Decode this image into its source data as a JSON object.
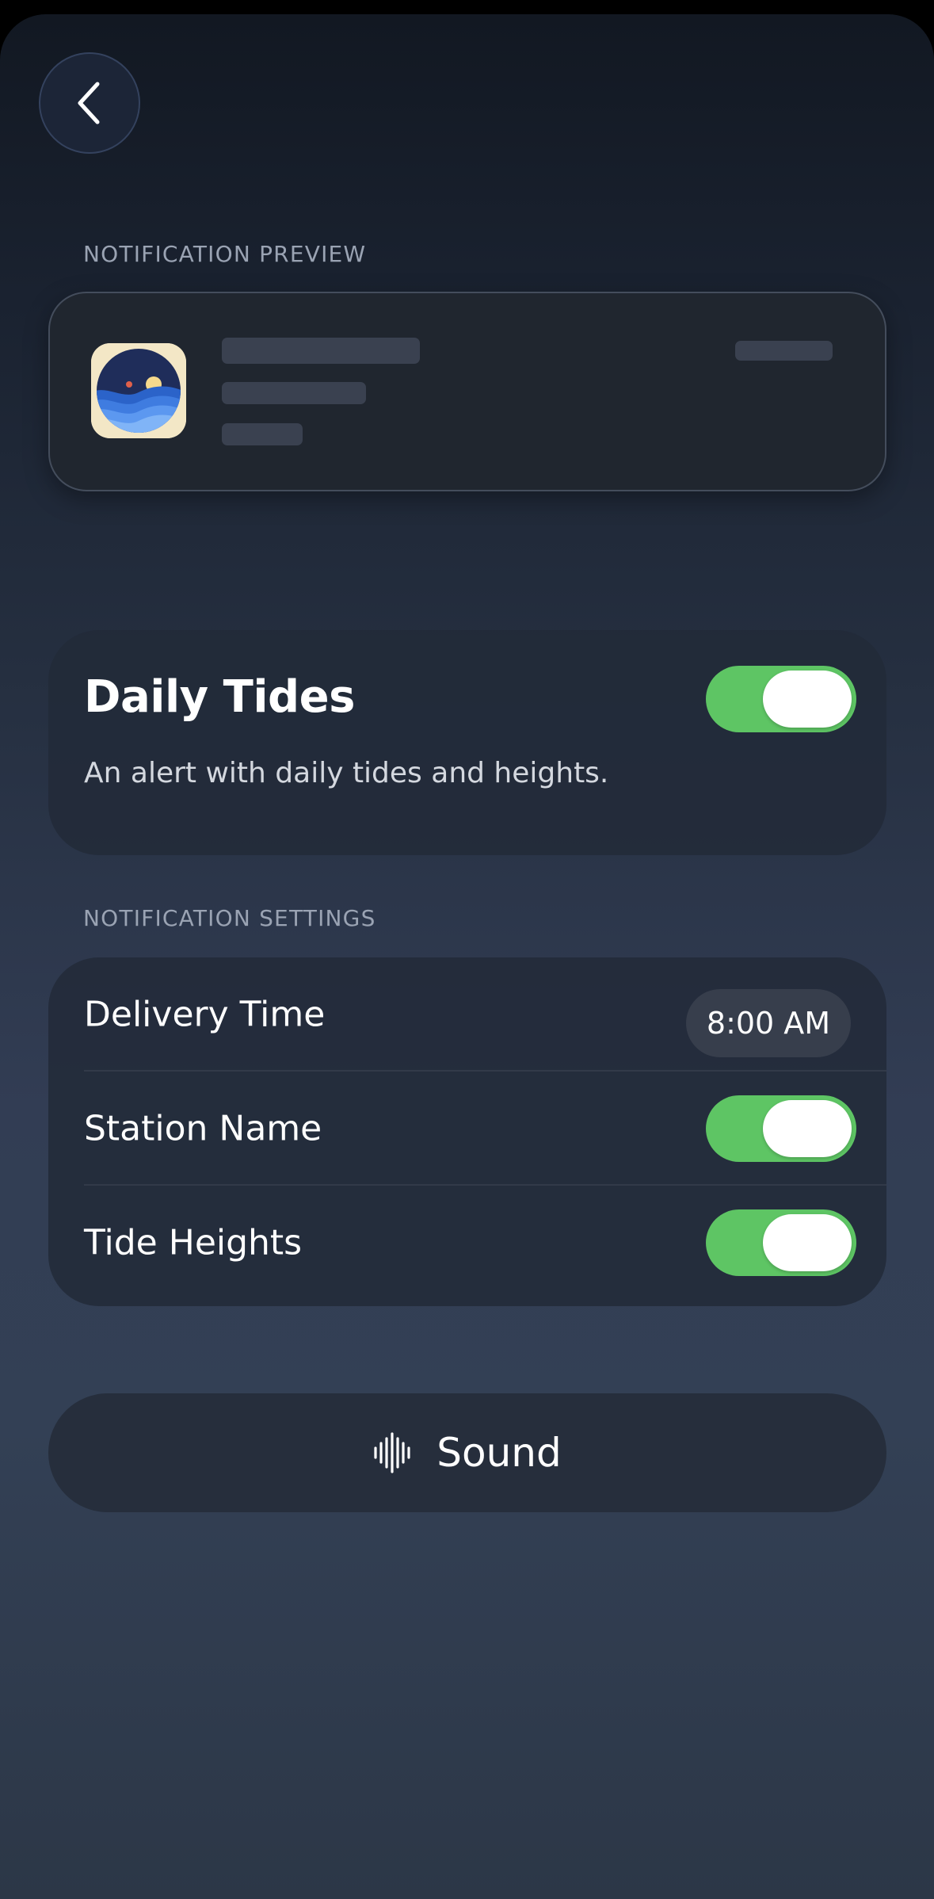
{
  "back": {
    "icon": "chevron-left-icon"
  },
  "preview": {
    "section_label": "NOTIFICATION PREVIEW",
    "app_icon": "tide-app-icon"
  },
  "daily_tides": {
    "title": "Daily Tides",
    "description": "An alert with daily tides and heights.",
    "enabled": true
  },
  "settings": {
    "section_label": "NOTIFICATION SETTINGS",
    "rows": [
      {
        "label": "Delivery Time",
        "value": "8:00 AM"
      },
      {
        "label": "Station Name",
        "enabled": true
      },
      {
        "label": "Tide Heights",
        "enabled": true
      }
    ]
  },
  "sound": {
    "label": "Sound",
    "icon": "waveform-icon"
  },
  "colors": {
    "toggle_on": "#5ec564",
    "card_background": "#222a38",
    "label_muted": "#9aa3b3"
  }
}
